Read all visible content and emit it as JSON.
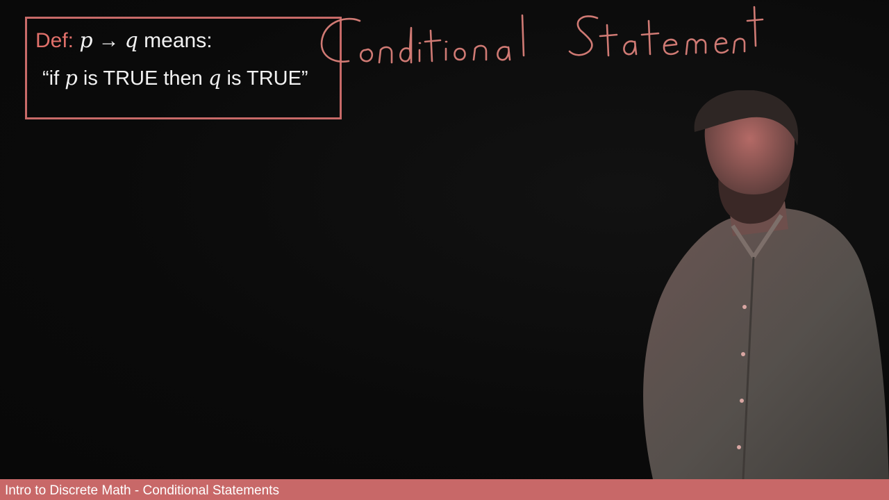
{
  "definition": {
    "label": "Def:",
    "p": "p",
    "arrow": "→",
    "q": "q",
    "means": "means:",
    "open_quote": "“if",
    "is_true_1": "is TRUE then",
    "is_true_2": "is TRUE”"
  },
  "handwritten_title": "Conditional Statement",
  "footer": {
    "title": "Intro to Discrete Math - Conditional Statements"
  },
  "colors": {
    "accent": "#c86868",
    "box_border": "#c86a68",
    "background": "#0b0b0b",
    "text": "#f2f2f2"
  }
}
